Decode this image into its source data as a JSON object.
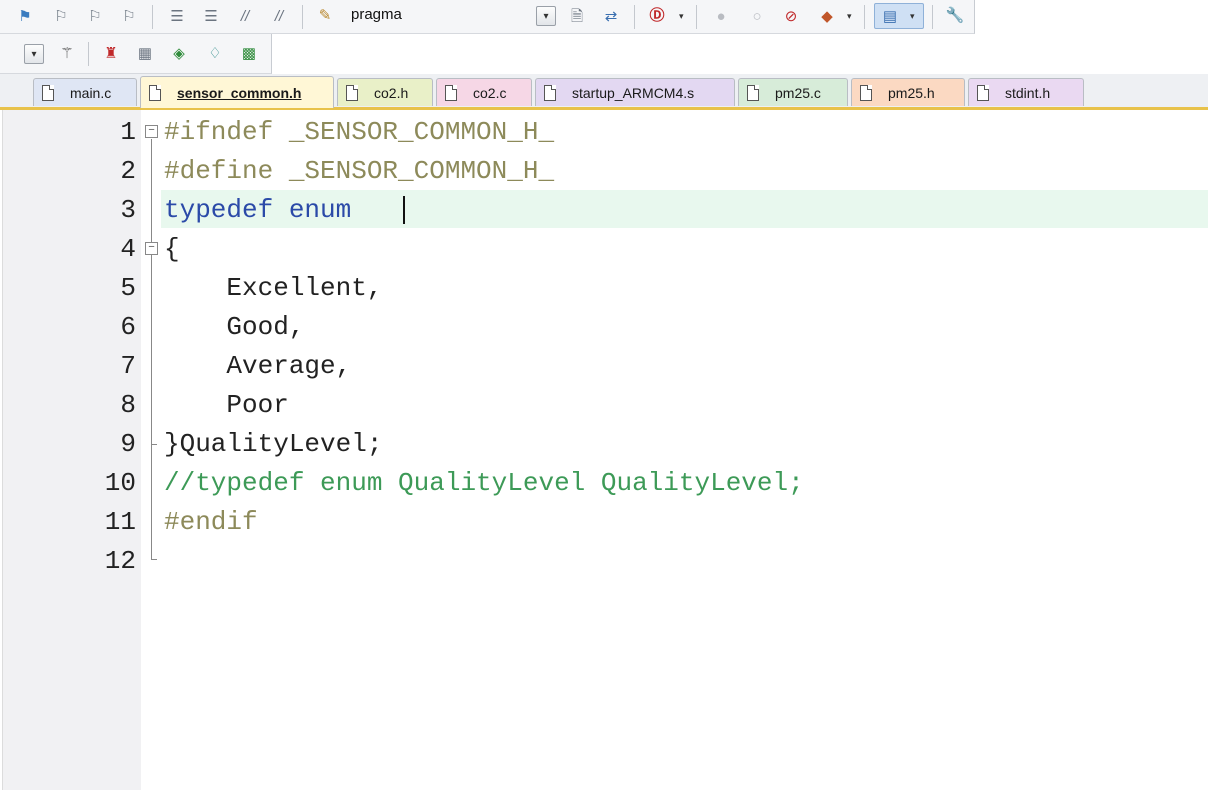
{
  "toolbar1": {
    "icons": [
      "bookmark-toggle-icon",
      "bookmark-prev-icon",
      "bookmark-next-icon",
      "bookmark-clear-icon",
      "indent-icon",
      "unindent-icon",
      "comment-icon",
      "uncomment-icon",
      "find-in-files-icon"
    ],
    "find_text": "pragma",
    "right_icons": [
      "incremental-find-icon",
      "find-references-icon",
      "debug-start-icon",
      "breakpoint-insert-icon",
      "breakpoint-enable-icon",
      "breakpoint-disable-icon",
      "breakpoint-kill-icon",
      "window-layout-icon",
      "configure-icon"
    ]
  },
  "toolbar2": {
    "icons": [
      "dropdown-icon",
      "magic-wand-icon",
      "pack-installer-icon",
      "manage-project-icon",
      "select-device-icon",
      "manage-runtime-icon",
      "batch-build-icon"
    ]
  },
  "tabs": [
    {
      "label": "main.c",
      "color": "#dfe6f4"
    },
    {
      "label": "sensor_common.h",
      "color": "#fff7d6",
      "active": true
    },
    {
      "label": "co2.h",
      "color": "#e9f0c8"
    },
    {
      "label": "co2.c",
      "color": "#f6d7e6"
    },
    {
      "label": "startup_ARMCM4.s",
      "color": "#e3d8f2"
    },
    {
      "label": "pm25.c",
      "color": "#d7ecd9"
    },
    {
      "label": "pm25.h",
      "color": "#fbd9c2"
    },
    {
      "label": "stdint.h",
      "color": "#ead9f2"
    }
  ],
  "editor": {
    "line_numbers": [
      "1",
      "2",
      "3",
      "4",
      "5",
      "6",
      "7",
      "8",
      "9",
      "10",
      "11",
      "12"
    ],
    "lines": [
      {
        "text": "#ifndef _SENSOR_COMMON_H_",
        "style": "pp"
      },
      {
        "text": "#define _SENSOR_COMMON_H_",
        "style": "pp"
      },
      {
        "text": "typedef enum",
        "style": "kw"
      },
      {
        "text": "{",
        "style": "tx"
      },
      {
        "text": "    Excellent,",
        "style": "tx"
      },
      {
        "text": "    Good,",
        "style": "tx"
      },
      {
        "text": "    Average,",
        "style": "tx"
      },
      {
        "text": "    Poor",
        "style": "tx"
      },
      {
        "text": "}QualityLevel;",
        "style": "tx"
      },
      {
        "text": "//typedef enum QualityLevel QualityLevel;",
        "style": "cm"
      },
      {
        "text": "#endif",
        "style": "pp"
      },
      {
        "text": "",
        "style": "tx"
      }
    ],
    "current_line": "3"
  },
  "colors": {
    "preprocessor": "#8d8a5a",
    "keyword": "#2b4aa8",
    "comment": "#3d9a57",
    "current_line_highlight": "#e8f8ee",
    "active_tab_underline": "#e8c24a"
  }
}
